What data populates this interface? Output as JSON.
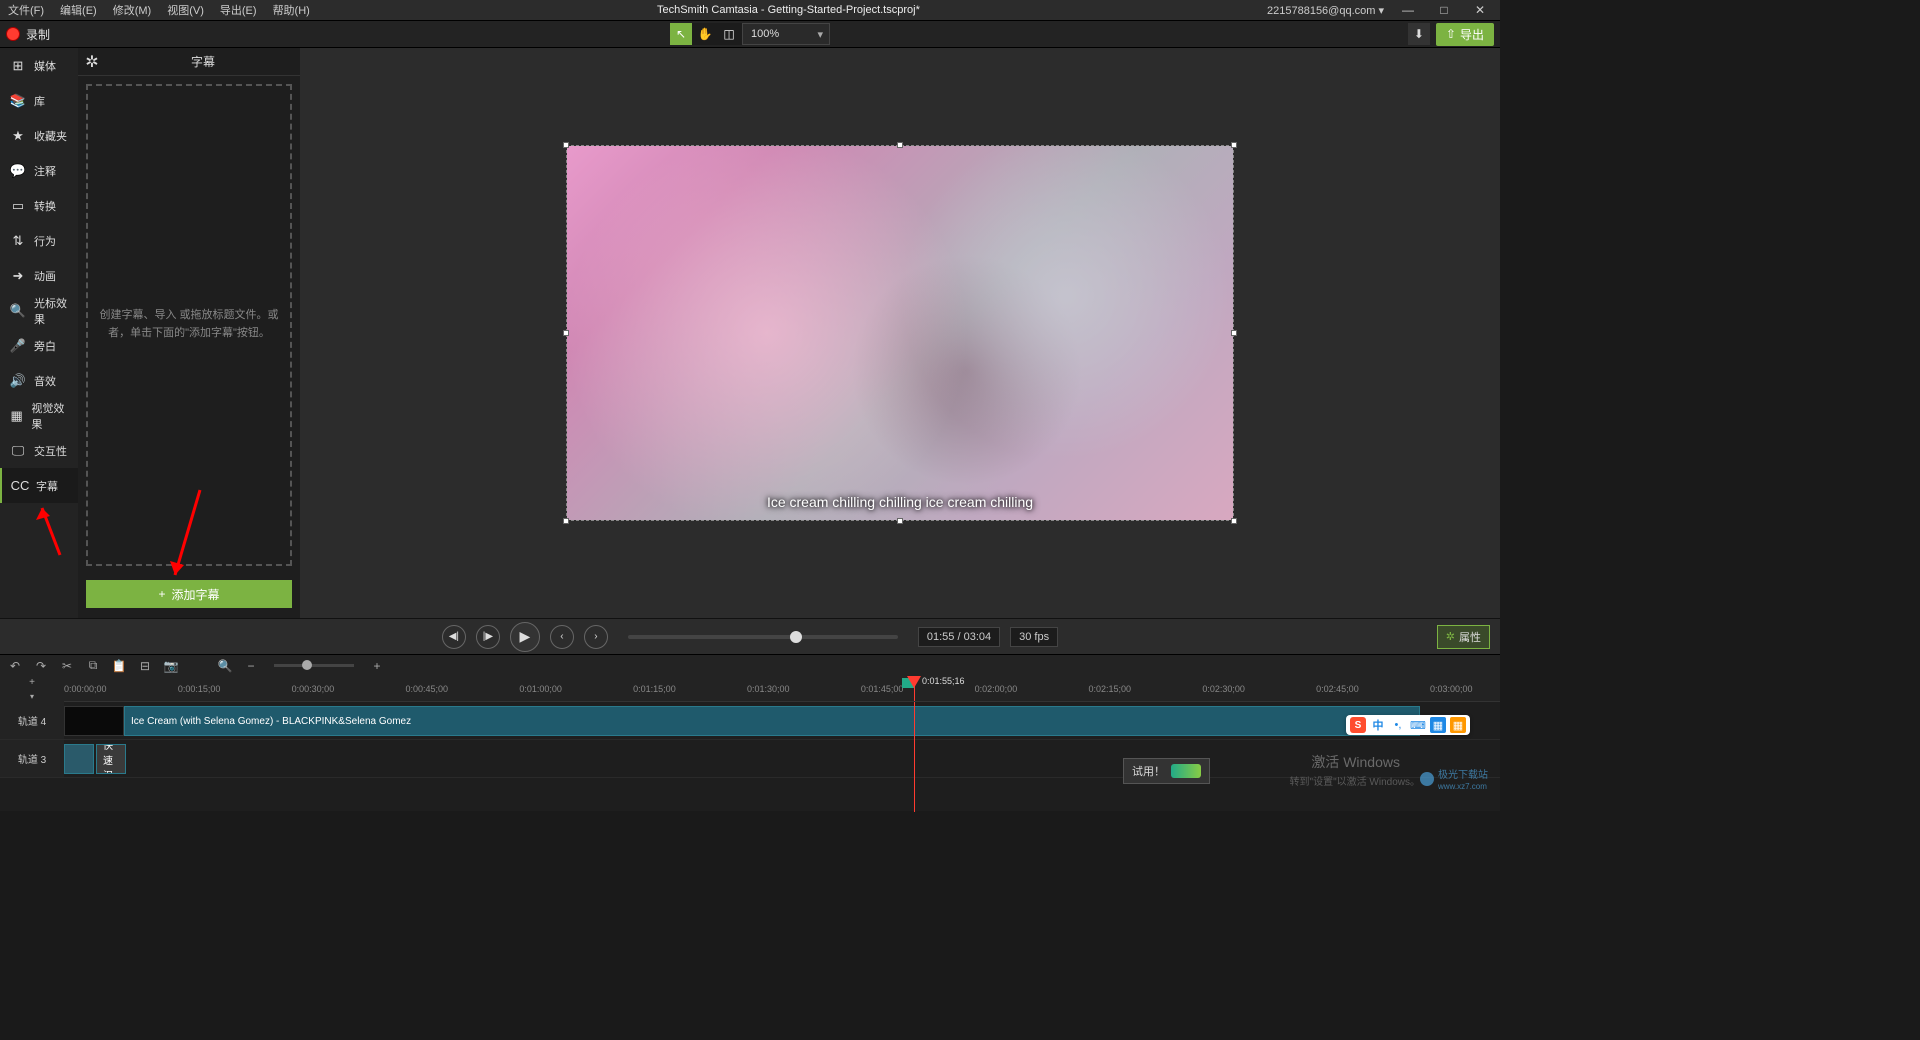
{
  "titlebar": {
    "menus": [
      "文件(F)",
      "编辑(E)",
      "修改(M)",
      "视图(V)",
      "导出(E)",
      "帮助(H)"
    ],
    "title": "TechSmith Camtasia - Getting-Started-Project.tscproj*",
    "account": "2215788156@qq.com ▾"
  },
  "toolbar": {
    "record": "录制",
    "zoom": "100%",
    "export": "导出"
  },
  "sidebar": {
    "items": [
      {
        "icon": "⊞",
        "label": "媒体"
      },
      {
        "icon": "📚",
        "label": "库"
      },
      {
        "icon": "★",
        "label": "收藏夹"
      },
      {
        "icon": "💬",
        "label": "注释"
      },
      {
        "icon": "▭",
        "label": "转换"
      },
      {
        "icon": "⇅",
        "label": "行为"
      },
      {
        "icon": "➜",
        "label": "动画"
      },
      {
        "icon": "🔍",
        "label": "光标效果"
      },
      {
        "icon": "🎤",
        "label": "旁白"
      },
      {
        "icon": "🔊",
        "label": "音效"
      },
      {
        "icon": "▦",
        "label": "视觉效果"
      },
      {
        "icon": "🖵",
        "label": "交互性"
      },
      {
        "icon": "CC",
        "label": "字幕"
      }
    ]
  },
  "panel": {
    "title": "字幕",
    "hint": "创建字幕、导入 或拖放标题文件。或者，单击下面的\"添加字幕\"按钮。",
    "addbtn": "添加字幕"
  },
  "canvas": {
    "caption": "Ice cream chilling chilling ice cream chilling"
  },
  "playback": {
    "time": "01:55 / 03:04",
    "fps": "30 fps",
    "props": "属性"
  },
  "timeline": {
    "playhead_time": "0:01:55;16",
    "marks": [
      "0:00:00;00",
      "0:00:15;00",
      "0:00:30;00",
      "0:00:45;00",
      "0:01:00;00",
      "0:01:15;00",
      "0:01:30;00",
      "0:01:45;00",
      "0:02:00;00",
      "0:02:15;00",
      "0:02:30;00",
      "0:02:45;00",
      "0:03:00;00"
    ],
    "track4": "轨道 4",
    "track3": "轨道 3",
    "clip_title": "Ice Cream (with Selena Gomez) - BLACKPINK&Selena Gomez",
    "clip_small": "快速汉"
  },
  "overlay": {
    "activate": "激活 Windows",
    "activate_sub": "转到\"设置\"以激活 Windows。",
    "tryit": "试用！",
    "watermark": "极光下载站",
    "watermark_url": "www.xz7.com"
  },
  "ime": {
    "lang": "中"
  }
}
